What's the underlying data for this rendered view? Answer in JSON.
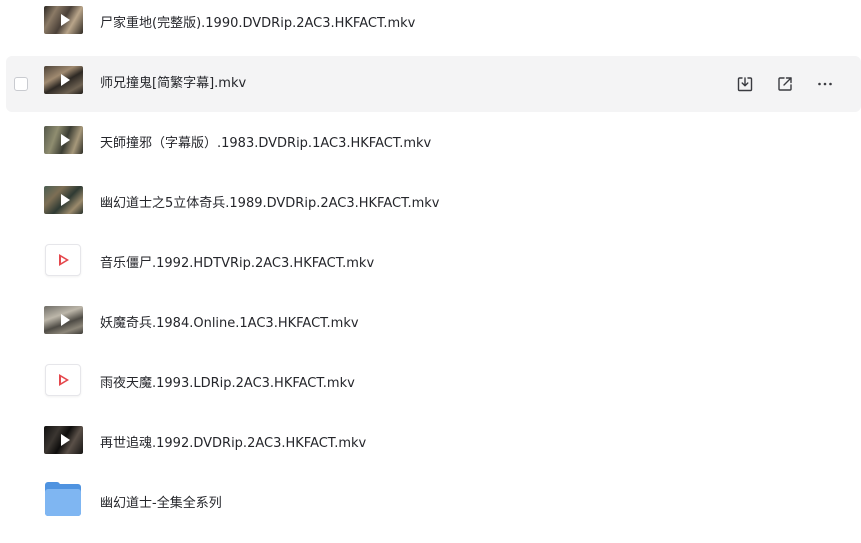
{
  "files": [
    {
      "name": "尸家重地(完整版).1990.DVDRip.2AC3.HKFACT.mkv",
      "kind": "video",
      "thumb_style": "v1"
    },
    {
      "name": "师兄撞鬼[简繁字幕].mkv",
      "kind": "video",
      "thumb_style": "v2",
      "hovered": true
    },
    {
      "name": "天師撞邪（字幕版）.1983.DVDRip.1AC3.HKFACT.mkv",
      "kind": "video",
      "thumb_style": "v3"
    },
    {
      "name": "幽幻道士之5立体奇兵.1989.DVDRip.2AC3.HKFACT.mkv",
      "kind": "video",
      "thumb_style": "v4"
    },
    {
      "name": "音乐僵尸.1992.HDTVRip.2AC3.HKFACT.mkv",
      "kind": "video-file"
    },
    {
      "name": "妖魔奇兵.1984.Online.1AC3.HKFACT.mkv",
      "kind": "video",
      "thumb_style": "v5"
    },
    {
      "name": "雨夜天魔.1993.LDRip.2AC3.HKFACT.mkv",
      "kind": "video-file"
    },
    {
      "name": "再世追魂.1992.DVDRip.2AC3.HKFACT.mkv",
      "kind": "video",
      "thumb_style": "v6"
    },
    {
      "name": "幽幻道士-全集全系列",
      "kind": "folder"
    }
  ],
  "hover_actions": [
    {
      "icon": "download-icon"
    },
    {
      "icon": "share-icon"
    },
    {
      "icon": "more-icon"
    }
  ],
  "colors": {
    "hover_row": "#f4f4f5",
    "text": "#25262b",
    "play_red": "#e5484d",
    "folder_blue": "#7fb6f2"
  }
}
